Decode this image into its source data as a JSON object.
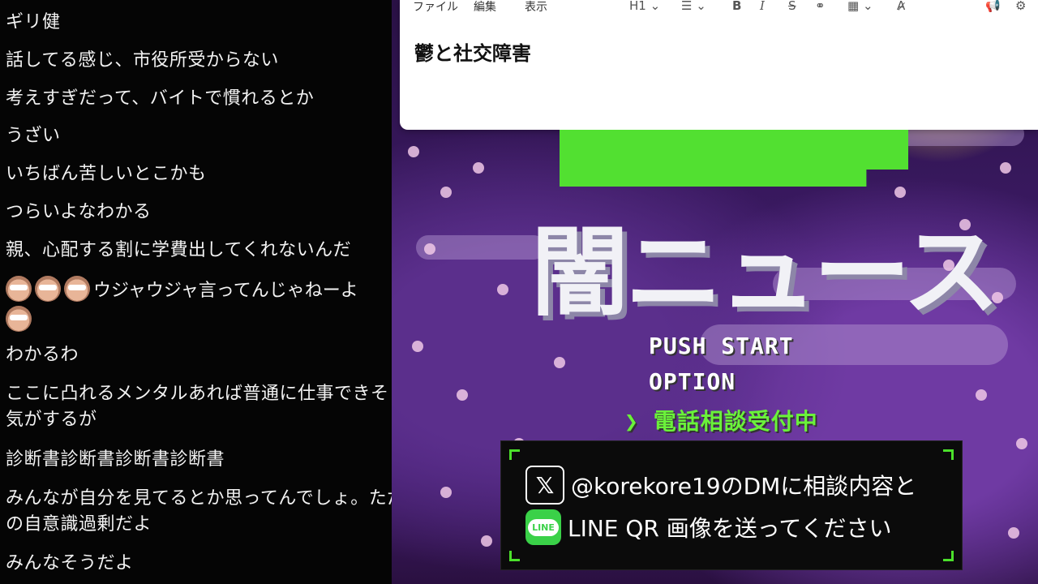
{
  "chat": {
    "messages": [
      "ギリ健",
      "話してる感じ、市役所受からない",
      "考えすぎだって、バイトで慣れるとか",
      "うざい",
      "いちばん苦しいとこかも",
      "つらいよなわかる",
      "親、心配する割に学費出してくれないんだ",
      "ウジャウジャ言ってんじゃねーよ",
      "わかるわ",
      "ここに凸れるメンタルあれば普通に仕事できそうな気がするが",
      "診断書診断書診断書診断書",
      "みんなが自分を見てるとか思ってんでしょ。ただの自意識過剰だよ",
      "みんなそうだよ"
    ]
  },
  "editor": {
    "menus": [
      "ファイル",
      "編集",
      "表示"
    ],
    "heading_tool": "H1",
    "title": "鬱と社交障害"
  },
  "stream": {
    "logo_sub": "闇ニュース",
    "menu": [
      "PUSH START",
      "OPTION",
      "電話相談受付中"
    ],
    "menu_arrow": "❯",
    "info_line1": "@korekore19のDMに相談内容と",
    "info_line2": "LINE QR 画像を送ってください",
    "x_icon_glyph": "𝕏",
    "line_icon_text": "LINE"
  }
}
